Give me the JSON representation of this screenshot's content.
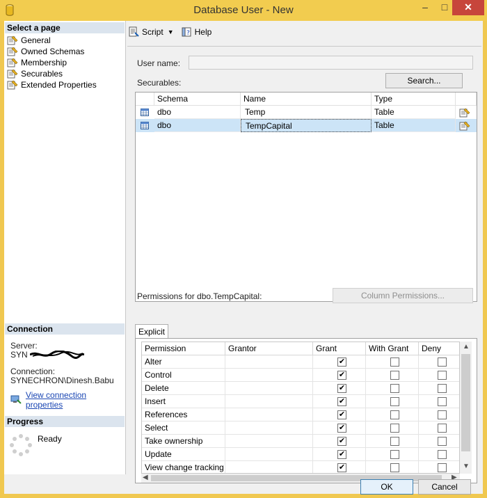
{
  "window": {
    "title": "Database User - New",
    "minimize": "–",
    "maximize": "□",
    "close": "✕"
  },
  "left_panel": {
    "select_page_header": "Select a page",
    "pages": [
      {
        "label": "General"
      },
      {
        "label": "Owned Schemas"
      },
      {
        "label": "Membership"
      },
      {
        "label": "Securables"
      },
      {
        "label": "Extended Properties"
      }
    ],
    "connection_header": "Connection",
    "server_label": "Server:",
    "server_value": "SYN",
    "connection_label": "Connection:",
    "connection_value": "SYNECHRON\\Dinesh.Babu",
    "view_connection_link": "View connection properties",
    "progress_header": "Progress",
    "progress_status": "Ready"
  },
  "toolbar": {
    "script_label": "Script",
    "help_label": "Help"
  },
  "form": {
    "user_name_label": "User name:",
    "user_name_value": "",
    "securables_label": "Securables:",
    "search_button": "Search..."
  },
  "securables_grid": {
    "columns": [
      "Schema",
      "Name",
      "Type"
    ],
    "rows": [
      {
        "schema": "dbo",
        "name": "Temp",
        "type": "Table",
        "selected": false
      },
      {
        "schema": "dbo",
        "name": "TempCapital",
        "type": "Table",
        "selected": true
      }
    ]
  },
  "permissions": {
    "label": "Permissions for dbo.TempCapital:",
    "column_permissions_button": "Column Permissions...",
    "tab_label": "Explicit",
    "columns": [
      "Permission",
      "Grantor",
      "Grant",
      "With Grant",
      "Deny"
    ],
    "rows": [
      {
        "permission": "Alter",
        "grantor": "",
        "grant": true,
        "with_grant": false,
        "deny": false
      },
      {
        "permission": "Control",
        "grantor": "",
        "grant": true,
        "with_grant": false,
        "deny": false
      },
      {
        "permission": "Delete",
        "grantor": "",
        "grant": true,
        "with_grant": false,
        "deny": false
      },
      {
        "permission": "Insert",
        "grantor": "",
        "grant": true,
        "with_grant": false,
        "deny": false
      },
      {
        "permission": "References",
        "grantor": "",
        "grant": true,
        "with_grant": false,
        "deny": false
      },
      {
        "permission": "Select",
        "grantor": "",
        "grant": true,
        "with_grant": false,
        "deny": false
      },
      {
        "permission": "Take ownership",
        "grantor": "",
        "grant": true,
        "with_grant": false,
        "deny": false
      },
      {
        "permission": "Update",
        "grantor": "",
        "grant": true,
        "with_grant": false,
        "deny": false
      },
      {
        "permission": "View change tracking",
        "grantor": "",
        "grant": true,
        "with_grant": false,
        "deny": false
      }
    ]
  },
  "buttons": {
    "ok": "OK",
    "cancel": "Cancel"
  }
}
